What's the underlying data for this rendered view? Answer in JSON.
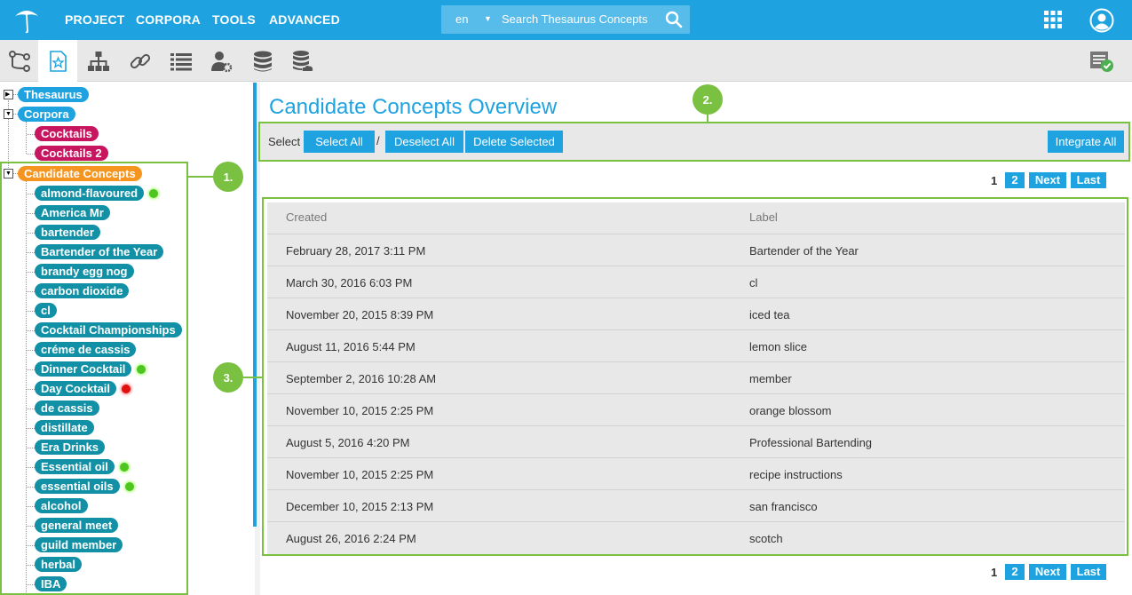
{
  "colors": {
    "accent": "#1fa3e0",
    "callout": "#7ac142",
    "teal_node": "#1190a6",
    "magenta_node": "#c8155f",
    "orange_node": "#f5941f"
  },
  "nav": {
    "items": [
      "PROJECT",
      "CORPORA",
      "TOOLS",
      "ADVANCED"
    ]
  },
  "search": {
    "lang": "en",
    "placeholder": "Search Thesaurus Concepts"
  },
  "toolbar": {
    "icons": [
      "hierarchy-branch-icon",
      "candidate-concepts-icon",
      "tree-structure-icon",
      "link-icon",
      "list-icon",
      "user-settings-icon",
      "database-icon",
      "database-cloud-icon"
    ],
    "right_icon": "approved-list-icon"
  },
  "tree": {
    "thesaurus": "Thesaurus",
    "corpora": "Corpora",
    "corpora_children": [
      "Cocktails",
      "Cocktails 2"
    ],
    "candidate": "Candidate Concepts",
    "candidate_children": [
      {
        "label": "almond-flavoured",
        "status": "green"
      },
      {
        "label": "America Mr",
        "status": ""
      },
      {
        "label": "bartender",
        "status": ""
      },
      {
        "label": "Bartender of the Year",
        "status": ""
      },
      {
        "label": "brandy egg nog",
        "status": ""
      },
      {
        "label": "carbon dioxide",
        "status": ""
      },
      {
        "label": "cl",
        "status": ""
      },
      {
        "label": "Cocktail Championships",
        "status": ""
      },
      {
        "label": "créme de cassis",
        "status": ""
      },
      {
        "label": "Dinner Cocktail",
        "status": "green"
      },
      {
        "label": "Day Cocktail",
        "status": "red"
      },
      {
        "label": "de cassis",
        "status": ""
      },
      {
        "label": "distillate",
        "status": ""
      },
      {
        "label": "Era Drinks",
        "status": ""
      },
      {
        "label": "Essential oil",
        "status": "green"
      },
      {
        "label": "essential oils",
        "status": "green"
      },
      {
        "label": "alcohol",
        "status": ""
      },
      {
        "label": "general meet",
        "status": ""
      },
      {
        "label": "guild member",
        "status": ""
      },
      {
        "label": "herbal",
        "status": ""
      },
      {
        "label": "IBA",
        "status": ""
      }
    ]
  },
  "callouts": [
    "1.",
    "2.",
    "3."
  ],
  "main": {
    "title": "Candidate Concepts Overview",
    "select_label": "Select",
    "slash": "/",
    "buttons": {
      "select_all": "Select All",
      "deselect_all": "Deselect All",
      "delete_selected": "Delete Selected",
      "integrate_all": "Integrate All"
    },
    "pager": {
      "current": "1",
      "page2": "2",
      "next": "Next",
      "last": "Last"
    },
    "table": {
      "headers": [
        "Created",
        "Label"
      ],
      "rows": [
        [
          "February 28, 2017 3:11 PM",
          "Bartender of the Year"
        ],
        [
          "March 30, 2016 6:03 PM",
          "cl"
        ],
        [
          "November 20, 2015 8:39 PM",
          "iced tea"
        ],
        [
          "August 11, 2016 5:44 PM",
          "lemon slice"
        ],
        [
          "September 2, 2016 10:28 AM",
          "member"
        ],
        [
          "November 10, 2015 2:25 PM",
          "orange blossom"
        ],
        [
          "August 5, 2016 4:20 PM",
          "Professional Bartending"
        ],
        [
          "November 10, 2015 2:25 PM",
          "recipe instructions"
        ],
        [
          "December 10, 2015 2:13 PM",
          "san francisco"
        ],
        [
          "August 26, 2016 2:24 PM",
          "scotch"
        ]
      ]
    }
  }
}
